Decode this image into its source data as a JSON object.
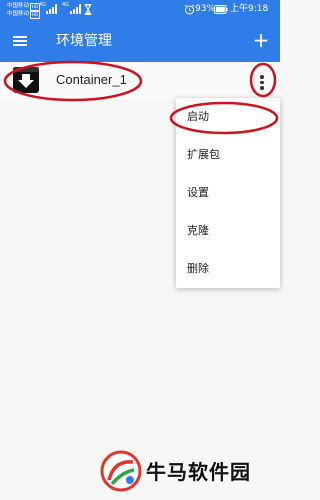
{
  "status_bar": {
    "carrier_1": "中国移动",
    "carrier_2": "中国移动",
    "hd_badge": "HD",
    "network_1": "4G",
    "network_2": "4G",
    "battery_percent": "93%",
    "time": "上午9:18",
    "icons": [
      "signal-icon",
      "hourglass-icon",
      "alarm-icon",
      "battery-icon"
    ]
  },
  "app_bar": {
    "title": "环境管理",
    "menu_icon": "menu-icon",
    "add_label": "+"
  },
  "containers": [
    {
      "label": "Container_1",
      "icon": "download-box-icon"
    }
  ],
  "popup_menu": {
    "items": [
      {
        "label": "启动"
      },
      {
        "label": "扩展包"
      },
      {
        "label": "设置"
      },
      {
        "label": "克隆"
      },
      {
        "label": "删除"
      }
    ]
  },
  "watermark": {
    "text": "牛马软件园"
  },
  "colors": {
    "primary": "#2f7de9",
    "annotation": "#d0121e",
    "background": "#f7f7f7"
  }
}
